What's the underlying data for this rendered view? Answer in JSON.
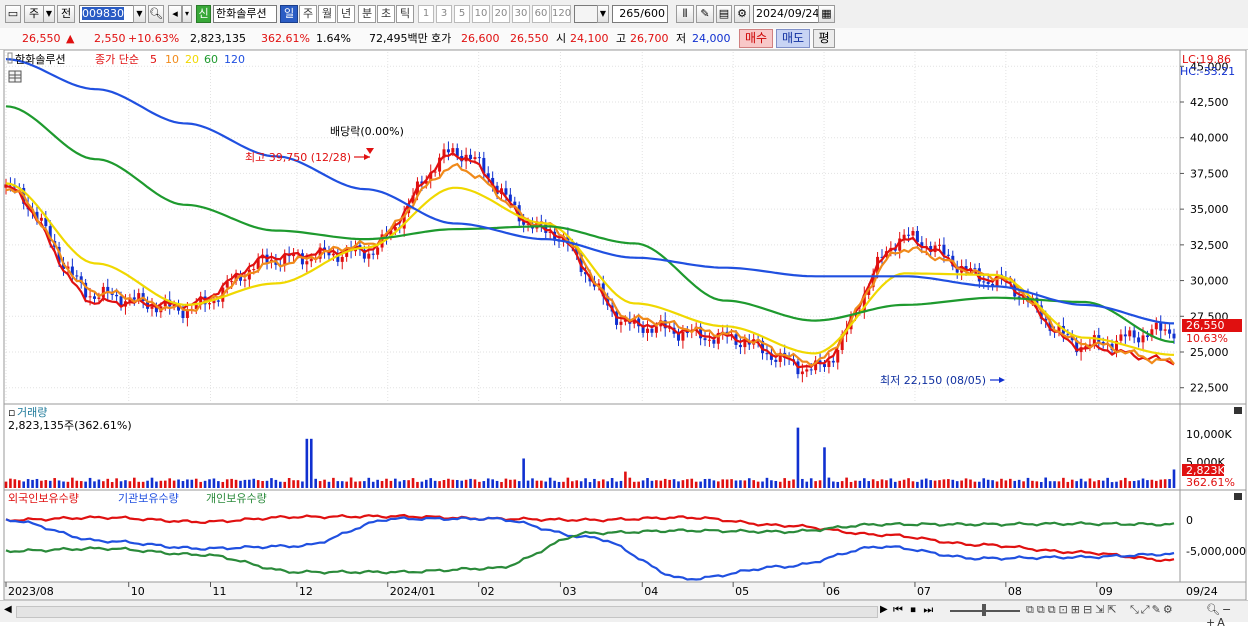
{
  "toolbar": {
    "market": "주",
    "prev": "전",
    "code": "009830",
    "new_badge": "신",
    "stock_name": "한화솔루션",
    "periods": [
      "일",
      "주",
      "월",
      "년",
      "분",
      "초",
      "틱"
    ],
    "numbers": [
      "1",
      "3",
      "5",
      "10",
      "20",
      "30",
      "60",
      "120"
    ],
    "count": "265",
    "count_total": "/600",
    "date": "2024/09/24"
  },
  "quote": {
    "price": "26,550",
    "arrow": "▲",
    "change": "2,550",
    "change_pct": "+10.63%",
    "volume": "2,823,135",
    "volume_ratio": "362.61%",
    "turnover": "1.64%",
    "amount": "72,495백만",
    "ask_label": "호가",
    "ask": "26,600",
    "bid": "26,550",
    "open_label": "시",
    "open": "24,100",
    "high_label": "고",
    "high": "26,700",
    "low_label": "저",
    "low": "24,000",
    "buy_button": "매수",
    "sell_button": "매도",
    "eval_button": "평"
  },
  "price_panel": {
    "legend_name": "한화솔루션",
    "legend_label": "종가 단순",
    "ma_labels": [
      "5",
      "10",
      "20",
      "60",
      "120"
    ],
    "ma_colors": [
      "#e01010",
      "#f08a1a",
      "#f0d800",
      "#1e9a2e",
      "#2050e0"
    ],
    "lc": "LC:19.86",
    "hc": "HC:-33.21",
    "y_ticks": [
      "45,000",
      "42,500",
      "40,000",
      "37,500",
      "35,000",
      "32,500",
      "30,000",
      "27,500",
      "25,000",
      "22,500"
    ],
    "last_price_tag": "26,550",
    "last_pct_tag": "10.63%",
    "dividend_note": "배당락(0.00%)",
    "high_note": "최고 39,750 (12/28)",
    "low_note": "최저 22,150 (08/05)"
  },
  "volume_panel": {
    "title": "거래량",
    "value": "2,823,135주(362.61%)",
    "y_ticks": [
      "10,000K",
      "5,000K"
    ],
    "last_tag": "2,823K",
    "last_pct": "362.61%"
  },
  "holding_panel": {
    "legend": [
      "외국인보유수량",
      "기관보유수량",
      "개인보유수량"
    ],
    "colors": [
      "#e01010",
      "#2050e0",
      "#2a8a3a"
    ],
    "y_ticks": [
      "0",
      "-5,000,000"
    ]
  },
  "x_axis": {
    "labels": [
      "2023/08",
      "10",
      "11",
      "12",
      "2024/01",
      "02",
      "03",
      "04",
      "05",
      "06",
      "07",
      "08",
      "09",
      "09/24"
    ]
  },
  "chart_data": {
    "type": "candlestick",
    "title": "한화솔루션",
    "ylim": [
      21500,
      46000
    ],
    "x": [
      "2023-08",
      "2023-09",
      "2023-10",
      "2023-11",
      "2023-12",
      "2024-01",
      "2024-02",
      "2024-03",
      "2024-04",
      "2024-05",
      "2024-06",
      "2024-07",
      "2024-08",
      "2024-09"
    ],
    "close": [
      36500,
      29000,
      28000,
      31500,
      32000,
      39000,
      33500,
      26800,
      26000,
      23800,
      33000,
      30000,
      25500,
      26550
    ],
    "series": [
      {
        "name": "5",
        "values": [
          36500,
          28500,
          28300,
          31700,
          32200,
          38800,
          33600,
          27000,
          26100,
          24000,
          32800,
          30100,
          25300,
          24400
        ]
      },
      {
        "name": "10",
        "values": [
          36500,
          29200,
          28000,
          31200,
          32500,
          37900,
          33900,
          27300,
          26300,
          24300,
          32200,
          30300,
          25600,
          24300
        ]
      },
      {
        "name": "20",
        "values": [
          36800,
          31200,
          28300,
          29800,
          32300,
          36500,
          34000,
          28400,
          26800,
          24900,
          30500,
          30400,
          26000,
          24800
        ]
      },
      {
        "name": "60",
        "values": [
          42200,
          38500,
          35300,
          33500,
          32900,
          33600,
          33800,
          32600,
          28600,
          27200,
          28300,
          28800,
          28500,
          25700
        ]
      },
      {
        "name": "120",
        "values": [
          45500,
          43400,
          41000,
          38700,
          36400,
          34000,
          32900,
          31600,
          30900,
          30300,
          30300,
          29600,
          28300,
          27000
        ]
      }
    ],
    "annotations": [
      "최고 39,750 (12/28)",
      "최저 22,150 (08/05)",
      "배당락(0.00%)"
    ],
    "volume_last": 2823135
  }
}
